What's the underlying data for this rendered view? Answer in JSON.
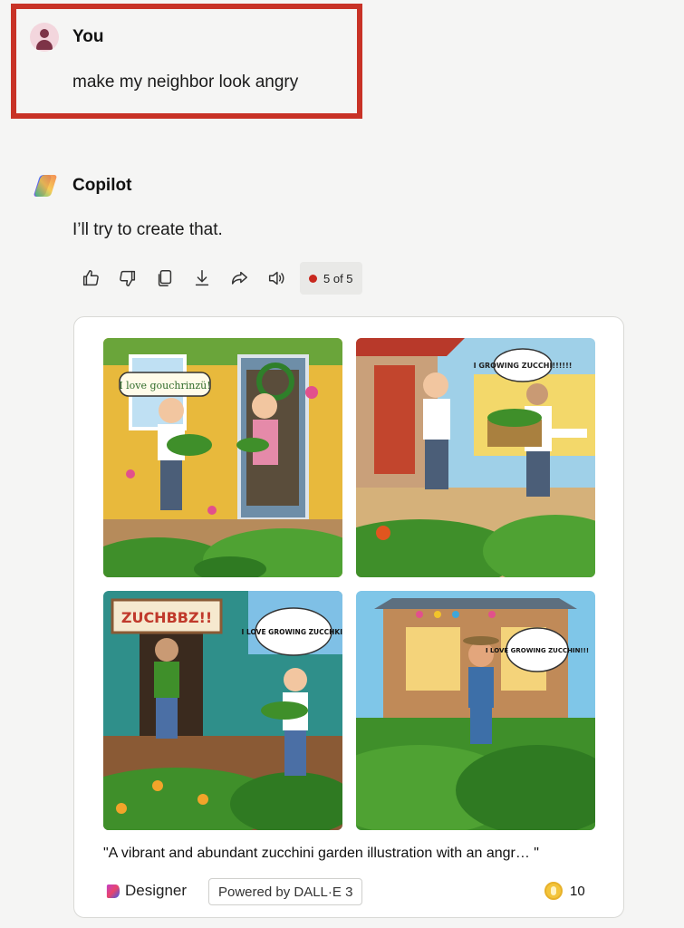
{
  "user_message": {
    "author": "You",
    "text": "make my neighbor look angry"
  },
  "copilot_message": {
    "author": "Copilot",
    "text": "I’ll try to create that.",
    "actions": [
      "thumbs-up-icon",
      "thumbs-down-icon",
      "copy-icon",
      "download-icon",
      "share-icon",
      "read-aloud-icon"
    ],
    "pager": "5 of 5"
  },
  "image_card": {
    "images": [
      {
        "speech": "I love gouchrinzü!"
      },
      {
        "speech": "I GROWING ZUCCHI!!!!!!"
      },
      {
        "speech": "I LOVE GROWING ZUCCHKI!",
        "sign": "ZUCHBBZ!!"
      },
      {
        "speech": "I LOVE GROWING ZUCCHIN!!!"
      }
    ],
    "caption": "\"A vibrant and abundant zucchini garden illustration with an angr… \"",
    "brand": "Designer",
    "powered_by": "Powered by DALL·E 3",
    "boosts": "10"
  },
  "colors": {
    "accent_red": "#c83226",
    "zucchini_green": "#3f8f2a",
    "background": "#f5f5f4"
  }
}
